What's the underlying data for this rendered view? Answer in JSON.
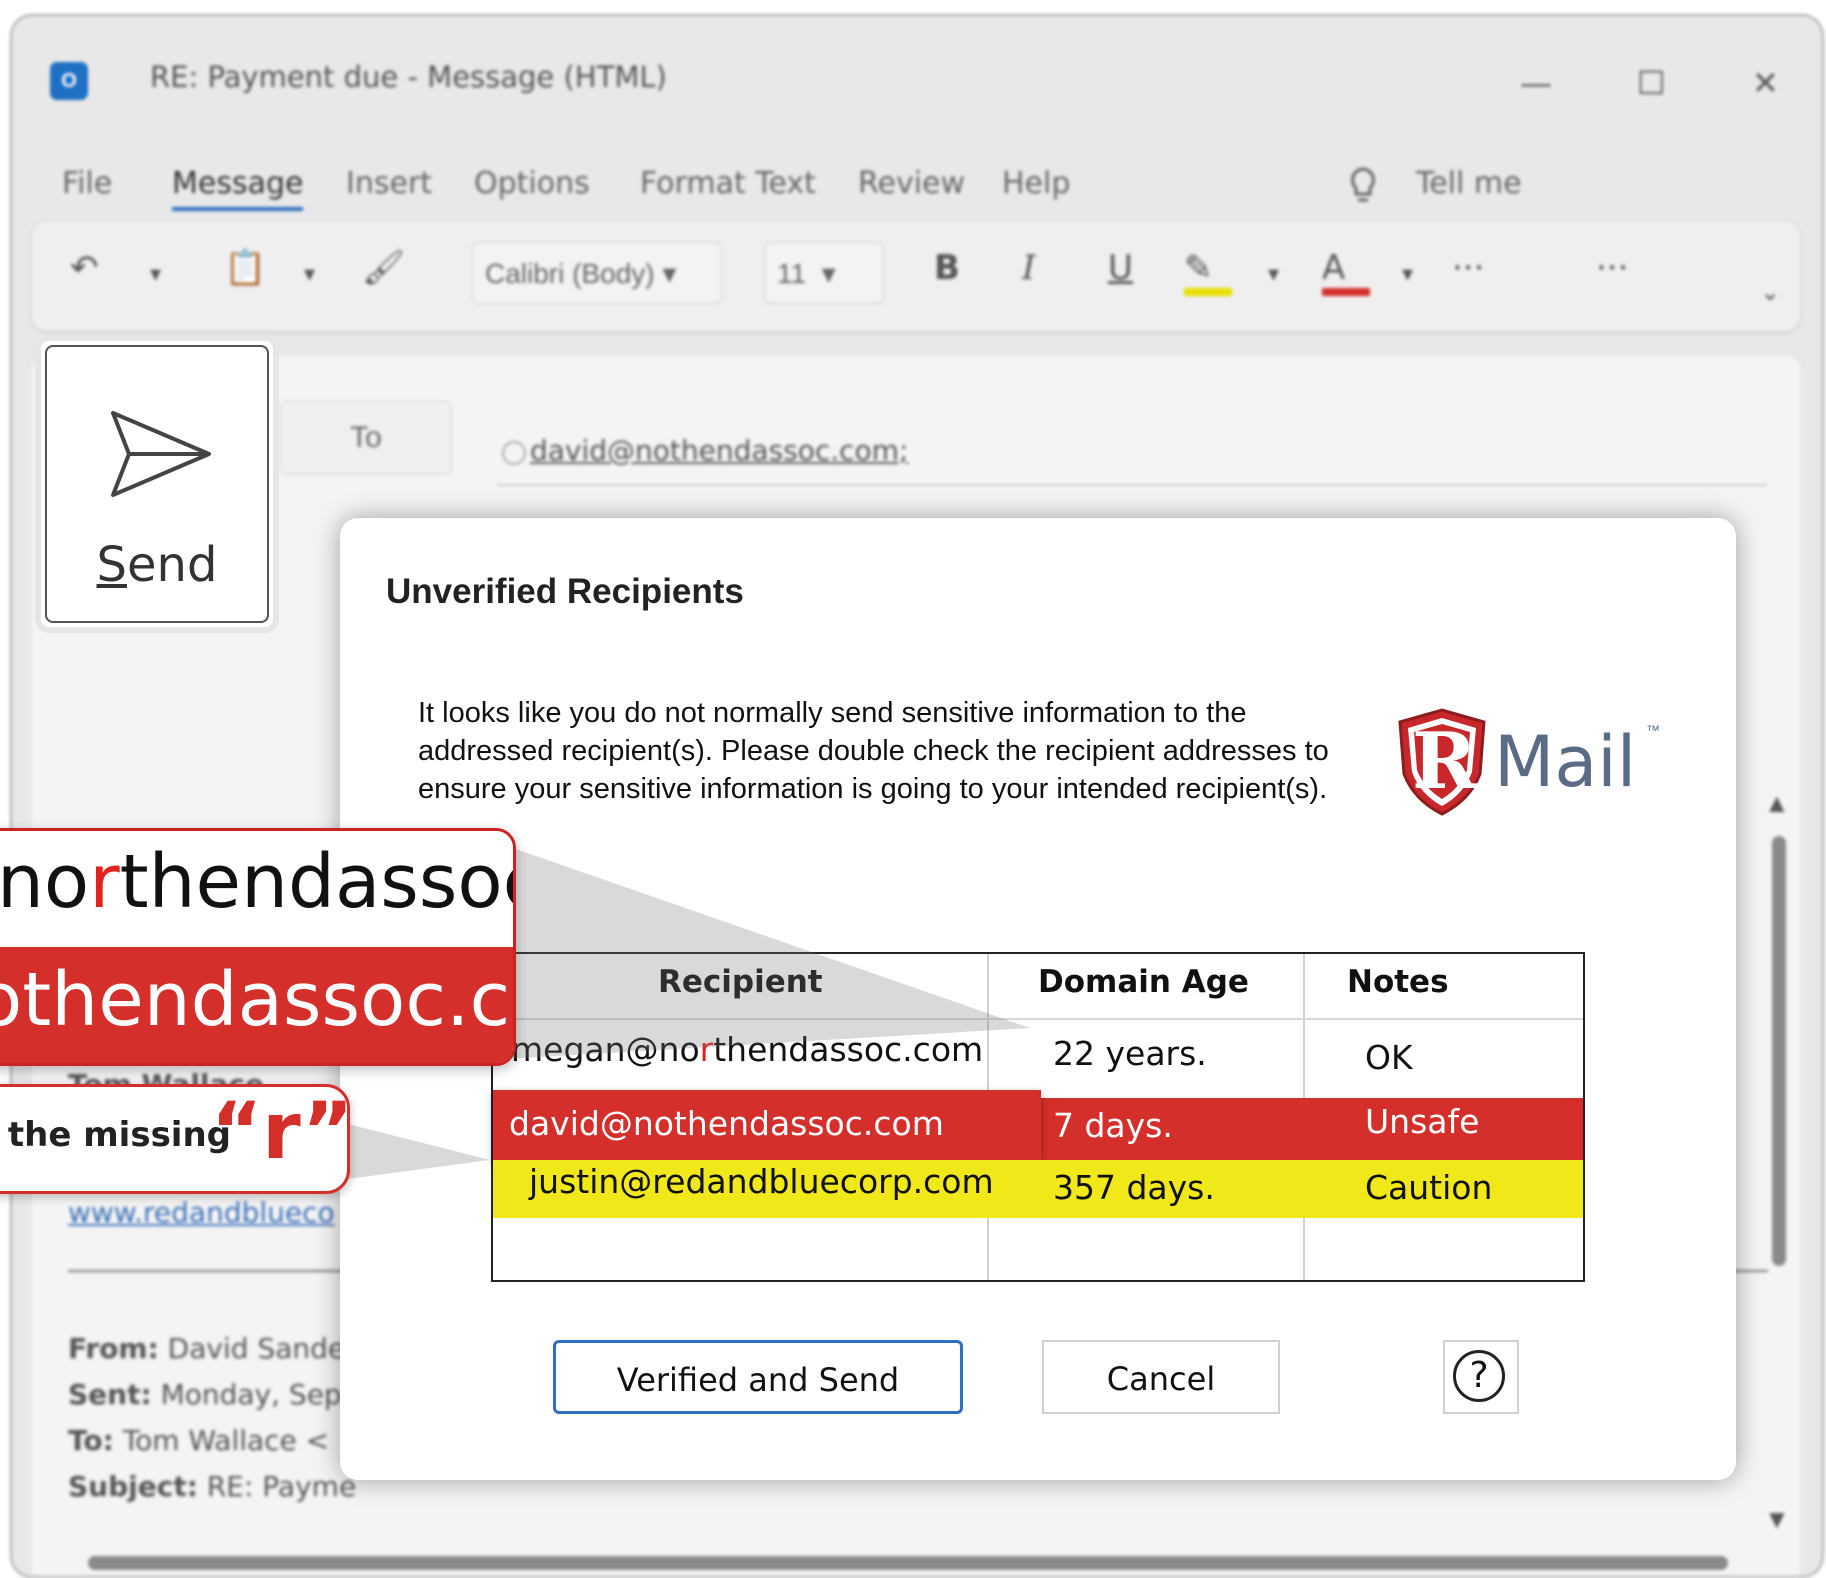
{
  "window": {
    "title": "RE: Payment due  -  Message (HTML)",
    "app_icon": "outlook-icon",
    "controls": {
      "minimize": "—",
      "maximize": "☐",
      "close": "✕"
    }
  },
  "menu": {
    "items": [
      "File",
      "Message",
      "Insert",
      "Options",
      "Format Text",
      "Review",
      "Help"
    ],
    "active": "Message",
    "tell_me": "Tell me"
  },
  "ribbon": {
    "font_name": "Calibri (Body)",
    "font_size": "11",
    "bold": "B",
    "italic": "I",
    "underline": "U",
    "font_color_letter": "A",
    "more": "···",
    "highlight_color": "#e8e000",
    "font_color": "#d42f2b"
  },
  "compose": {
    "to_label": "To",
    "to_address": "david@nothendassoc.com;",
    "signature_name": "Tom Wallace",
    "signature_link": "www.redandblueco",
    "header_from_label": "From:",
    "header_from_value": "David Sande",
    "header_sent_label": "Sent:",
    "header_sent_value": "Monday, Sep",
    "header_to_label": "To:",
    "header_to_value": "Tom Wallace <",
    "header_subject_label": "Subject:",
    "header_subject_value": "RE: Payme"
  },
  "send": {
    "label_underlined": "S",
    "label_rest": "end",
    "icon": "send-icon"
  },
  "dialog": {
    "title": "Unverified Recipients",
    "message": "It looks like you do not normally send sensitive information to the addressed recipient(s). Please double check the recipient addresses to ensure your sensitive information is going to your intended recipient(s).",
    "logo_letter": "R",
    "logo_text": "Mail",
    "logo_tm": "™",
    "table": {
      "headers": [
        "Recipient",
        "Domain Age",
        "Notes"
      ],
      "rows": [
        {
          "recipient_pre": "megan@no",
          "recipient_hl": "r",
          "recipient_post": "thendassoc.com",
          "domain_age": "22 years.",
          "notes": "OK",
          "status": "ok"
        },
        {
          "recipient_pre": "david@nothendassoc.com",
          "recipient_hl": "",
          "recipient_post": "",
          "domain_age": "7 days.",
          "notes": "Unsafe",
          "status": "unsafe"
        },
        {
          "recipient_pre": "justin@redandbluecorp.com",
          "recipient_hl": "",
          "recipient_post": "",
          "domain_age": "357 days.",
          "notes": "Caution",
          "status": "caution"
        }
      ]
    },
    "buttons": {
      "verify": "Verified and Send",
      "cancel": "Cancel",
      "help": "?"
    },
    "colors": {
      "unsafe": "#d42f2b",
      "caution": "#f0e818",
      "accent": "#2f6fc0",
      "r_highlight": "#e0231f"
    }
  },
  "zoom": {
    "top_pre": "no",
    "top_hl": "r",
    "top_post": "thendassoc.",
    "bottom": "othendassoc.co",
    "hint_text": "e the missing",
    "hint_r": "“r”"
  }
}
